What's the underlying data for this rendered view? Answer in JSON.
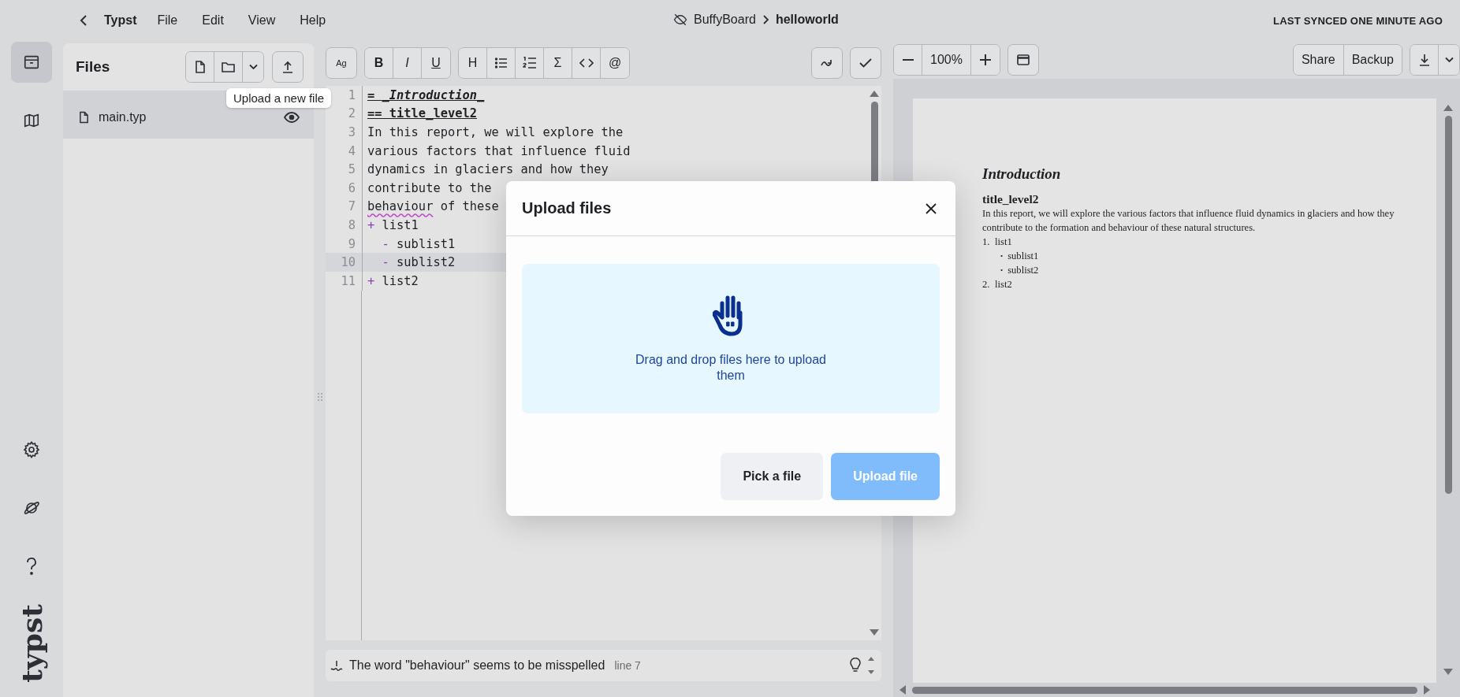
{
  "app": {
    "name": "Typst",
    "menus": [
      {
        "label": "File"
      },
      {
        "label": "Edit"
      },
      {
        "label": "View"
      },
      {
        "label": "Help"
      }
    ]
  },
  "breadcrumb": {
    "project": "BuffyBoard",
    "file": "helloworld"
  },
  "sync_status": "LAST SYNCED ONE MINUTE AGO",
  "rail": {
    "items": [
      {
        "kind": "archive",
        "selected": true
      },
      {
        "kind": "map",
        "selected": false
      }
    ],
    "bottom": [
      {
        "kind": "settings"
      },
      {
        "kind": "planet"
      },
      {
        "kind": "help"
      }
    ],
    "logo": "typst"
  },
  "files": {
    "title": "Files",
    "tooltip": "Upload a new file",
    "items": [
      {
        "name": "main.typ",
        "selected": true
      }
    ]
  },
  "toolbar": {
    "font_button": "Ag",
    "format": [
      {
        "kind": "bold",
        "label": "B"
      },
      {
        "kind": "italic",
        "label": "I"
      },
      {
        "kind": "underline",
        "label": "U"
      }
    ],
    "insert": [
      {
        "kind": "heading",
        "label": "H"
      },
      {
        "kind": "bullet_list"
      },
      {
        "kind": "numbered_list"
      },
      {
        "kind": "math",
        "label": "Σ"
      },
      {
        "kind": "code"
      },
      {
        "kind": "reference",
        "label": "@"
      }
    ],
    "zoom": "100%",
    "actions": [
      {
        "label": "Share"
      },
      {
        "label": "Backup"
      }
    ]
  },
  "editor": {
    "lines": [
      {
        "number": "1",
        "current": false,
        "segments": [
          {
            "text": "= ",
            "kind": "heading"
          },
          {
            "text": "_Introduction_",
            "kind": "heading_italic"
          }
        ]
      },
      {
        "number": "2",
        "current": false,
        "segments": [
          {
            "text": "== title_level2",
            "kind": "heading"
          }
        ]
      },
      {
        "number": "3",
        "current": false,
        "segments": [
          {
            "text": "In this report, we will explore the",
            "kind": "plain"
          }
        ]
      },
      {
        "number": "4",
        "current": false,
        "segments": [
          {
            "text": "various factors that influence fluid",
            "kind": "plain"
          }
        ]
      },
      {
        "number": "5",
        "current": false,
        "segments": [
          {
            "text": "dynamics in glaciers and how they",
            "kind": "plain"
          }
        ]
      },
      {
        "number": "6",
        "current": false,
        "segments": [
          {
            "text": "contribute to the",
            "kind": "plain"
          }
        ]
      },
      {
        "number": "7",
        "current": false,
        "segments": [
          {
            "text": "behaviour",
            "kind": "misspelled"
          },
          {
            "text": " of these",
            "kind": "plain"
          }
        ]
      },
      {
        "number": "8",
        "current": false,
        "segments": [
          {
            "text": "+ ",
            "kind": "marker"
          },
          {
            "text": "list1",
            "kind": "plain"
          }
        ]
      },
      {
        "number": "9",
        "current": false,
        "segments": [
          {
            "text": "  - ",
            "kind": "marker"
          },
          {
            "text": "sublist1",
            "kind": "plain"
          }
        ]
      },
      {
        "number": "10",
        "current": true,
        "segments": [
          {
            "text": "  - ",
            "kind": "marker"
          },
          {
            "text": "sublist2",
            "kind": "plain"
          }
        ]
      },
      {
        "number": "11",
        "current": false,
        "segments": [
          {
            "text": "+ ",
            "kind": "marker"
          },
          {
            "text": "list2",
            "kind": "plain"
          }
        ]
      }
    ]
  },
  "diagnostic": {
    "message": "The word \"behaviour\" seems to be misspelled",
    "location": "line 7"
  },
  "preview": {
    "heading": "Introduction",
    "subheading": "title_level2",
    "paragraph": "In this report, we will explore the various factors that influence fluid dynamics in glaciers and how they contribute to the formation and behaviour of these natural structures.",
    "list": [
      {
        "marker": "1.",
        "text": "list1",
        "children": [
          {
            "marker": "•",
            "text": "sublist1"
          },
          {
            "marker": "•",
            "text": "sublist2"
          }
        ]
      },
      {
        "marker": "2.",
        "text": "list2"
      }
    ]
  },
  "dialog": {
    "title": "Upload files",
    "dropzone_text": "Drag and drop files here to upload them",
    "buttons": [
      {
        "label": "Pick a file",
        "kind": "secondary",
        "disabled": false
      },
      {
        "label": "Upload file",
        "kind": "primary",
        "disabled": true
      }
    ]
  }
}
